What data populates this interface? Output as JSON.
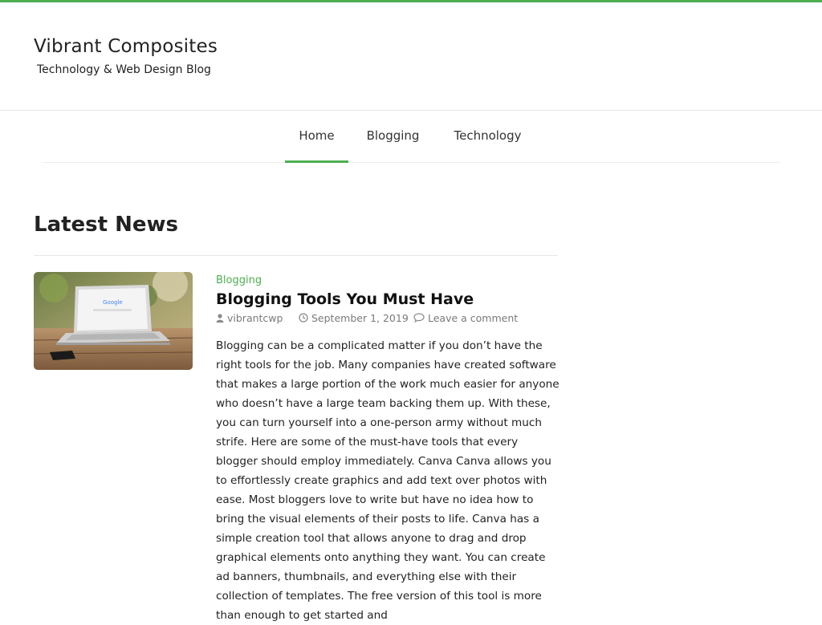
{
  "site": {
    "title": "Vibrant Composites",
    "tagline": "Technology & Web Design Blog"
  },
  "nav": {
    "items": [
      {
        "label": "Home",
        "active": true
      },
      {
        "label": "Blogging",
        "active": false
      },
      {
        "label": "Technology",
        "active": false
      }
    ]
  },
  "main": {
    "section_title": "Latest News",
    "post": {
      "category": "Blogging",
      "title": "Blogging Tools You Must Have",
      "author": "vibrantcwp",
      "date": "September 1, 2019",
      "comments": "Leave a comment",
      "thumbnail_icon": "laptop-image",
      "excerpt": "Blogging can be a complicated matter if you don’t have the right tools for the job. Many companies have created software that makes a large portion of the work much easier for anyone who doesn’t have a large team backing them up. With these, you can turn yourself into a one-person army without much strife. Here are some of the must-have tools that every blogger should employ immediately. Canva Canva allows you to effortlessly create graphics and add text over photos with ease. Most bloggers love to write but have no idea how to bring the visual elements of their posts to life. Canva has a simple creation tool that allows anyone to drag and drop graphical elements onto anything they want. You can create ad banners, thumbnails, and everything else with their collection of templates. The free version of this tool is more than enough to get started and"
    }
  },
  "colors": {
    "accent": "#4caf50",
    "text": "#222222",
    "meta": "#7a7a7a"
  },
  "icons": {
    "author": "user-icon",
    "date": "clock-icon",
    "comments": "comment-icon"
  }
}
